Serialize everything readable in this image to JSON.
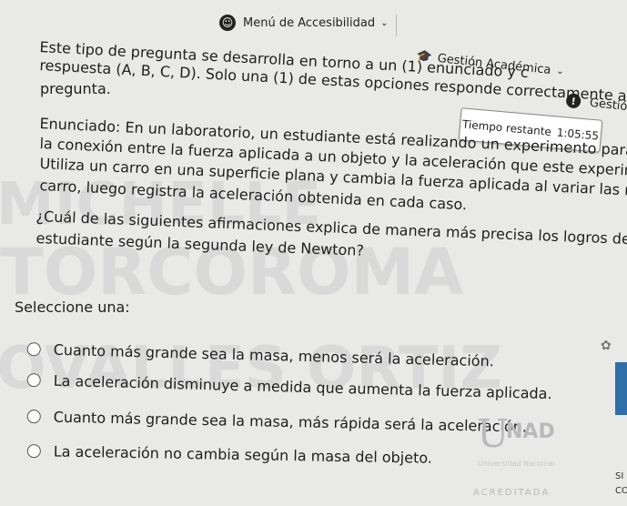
{
  "watermark": {
    "line1": "MICHELLE",
    "line2": "TORCOROMA",
    "line3": "OVALLES ORTIZ"
  },
  "topbar": {
    "accessibility_menu": "Menú de Accesibilidad",
    "academic_menu": "Gestión Académica",
    "gestion_cut": "Gestión"
  },
  "timer": {
    "label": "Tiempo restante",
    "value": "1:05:55"
  },
  "question": {
    "instructions_line1": "Este tipo de pregunta se desarrolla en torno a un (1) enunciado y c",
    "instructions_line2": "respuesta (A, B, C, D). Solo una (1) de estas opciones responde correctamente a la",
    "instructions_line3": "pregunta.",
    "statement_line1": "Enunciado: En un laboratorio, un estudiante está realizando un experimento para examinar",
    "statement_line2": "la conexión entre la fuerza aplicada a un objeto y la aceleración que este experimenta.",
    "statement_line3": "Utiliza un carro en una superficie plana y cambia la fuerza aplicada al variar las masas en el",
    "statement_line4": "carro, luego registra la aceleración obtenida en cada caso.",
    "prompt_line1": "¿Cuál de las siguientes afirmaciones explica de manera más precisa los logros del",
    "prompt_line2": "estudiante según la segunda ley de Newton?",
    "select_label": "Seleccione una:",
    "options": [
      "Cuanto más grande sea la masa, menos será la aceleración.",
      "La aceleración disminuye a medida que aumenta la fuerza aplicada.",
      "Cuanto más grande sea la masa, más rápida será la aceleración.",
      "La aceleración no cambia según la masa del objeto."
    ]
  },
  "logo": {
    "u": "U",
    "nad": "NAD",
    "subtitle": "Universidad Nacional",
    "acreditada": "ACREDITADA"
  },
  "corner": {
    "text1": "SI",
    "text2": "CO"
  }
}
